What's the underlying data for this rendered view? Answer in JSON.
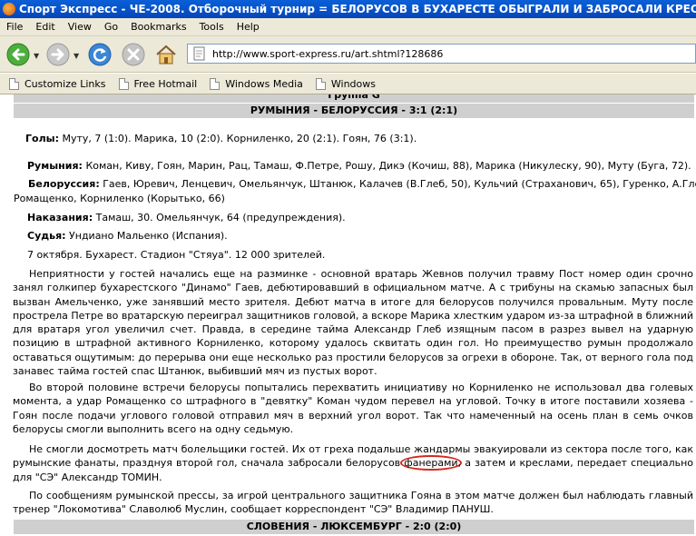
{
  "window": {
    "title": "Спорт Экспресс - ЧЕ-2008. Отборочный турнир = БЕЛОРУСОВ В БУХАРЕСТЕ ОБЫГРАЛИ И ЗАБРОСАЛИ КРЕСЛАМИ = Группа G = РУМ"
  },
  "menu": {
    "file": "File",
    "edit": "Edit",
    "view": "View",
    "go": "Go",
    "bookmarks": "Bookmarks",
    "tools": "Tools",
    "help": "Help"
  },
  "address": {
    "url": "http://www.sport-express.ru/art.shtml?128686"
  },
  "bookmarks": [
    {
      "label": "Customize Links"
    },
    {
      "label": "Free Hotmail"
    },
    {
      "label": "Windows Media"
    },
    {
      "label": "Windows"
    }
  ],
  "article": {
    "group_header": "Группа G",
    "match_header": "РУМЫНИЯ - БЕЛОРУССИЯ - 3:1 (2:1)",
    "goals_label": "Голы:",
    "goals_text": " Муту, 7 (1:0). Марика, 10 (2:0). Корниленко, 20 (2:1). Гоян, 76 (3:1).",
    "romania_label": "Румыния:",
    "romania_text": " Коман, Киву, Гоян, Марин, Рац, Тамаш, Ф.Петре, Рошу, Дикэ (Кочиш, 88), Марика (Никулеску, 90), Муту (Буга, 72).",
    "belarus_label": "Белоруссия:",
    "belarus_text_1": " Гаев, Юревич, Ленцевич, Омельянчук, Штанюк, Калачев (В.Глеб, 50), Кульчий (Страханович, 65), Гуренко, А.Глеб,",
    "belarus_text_2": "Ромащенко, Корниленко (Корытько, 66)",
    "cautions_label": "Наказания:",
    "cautions_text": " Тамаш, 30. Омельянчук, 64 (предупреждения).",
    "referee_label": "Судья:",
    "referee_text": " Ундиано Мальенко (Испания).",
    "venue": "7 октября. Бухарест. Стадион \"Стяуа\". 12 000 зрителей.",
    "paragraph_1": "Неприятности у гостей начались еще на разминке - основной вратарь Жевнов получил травму Пост номер один срочно занял голкипер бухарестского \"Динамо\" Гаев, дебютировавший в официальном матче. А с трибуны на скамью запасных был вызван Амельченко, уже занявший место зрителя. Дебют матча в итоге для белорусов получился провальным. Муту после прострела Петре во вратарскую переиграл защитников головой, а вскоре Марика хлестким ударом из-за штрафной в ближний для вратаря угол увеличил счет. Правда, в середине тайма Александр Глеб изящным пасом в разрез вывел на ударную позицию в штрафной активного Корниленко, которому удалось сквитать один гол. Но преимущество румын продолжало оставаться ощутимым: до перерыва они еще несколько раз простили белорусов за огрехи в обороне. Так, от верного гола под занавес тайма гостей спас Штанюк, выбивший мяч из пустых ворот.",
    "paragraph_2": "Во второй половине встречи белорусы попытались перехватить инициативу но Корниленко не использовал два голевых момента, а удар Ромащенко со штрафного в \"девятку\" Коман чудом перевел на угловой. Точку в итоге поставили хозяева - Гоян после подачи углового головой отправил мяч в верхний угол ворот. Так что намеченный на осень план в семь очков белорусы смогли выполнить всего на одну седьмую.",
    "paragraph_3a": "Не смогли досмотреть матч болельщики гостей. Их от греха подальше жандармы эвакуировали из сектора после того, как румынские фанаты, празднуя второй гол, сначала забросали белорусов ",
    "paragraph_3_circled": "фанерами",
    "paragraph_3b": ", а затем и креслами, передает специально для \"СЭ\" Александр ТОМИН.",
    "paragraph_4": "По сообщениям румынской прессы, за игрой центрального защитника Гояна в этом матче должен был наблюдать главный тренер \"Локомотива\" Славолюб Муслин, сообщает корреспондент \"СЭ\" Владимир ПАНУШ.",
    "next_match_header": "СЛОВЕНИЯ - ЛЮКСЕМБУРГ - 2:0 (2:0)"
  },
  "colors": {
    "titlebar": "#0a5fd8",
    "chrome": "#ece9d8",
    "header_bar": "#cfcfcf",
    "annotation_circle": "#d4291f"
  }
}
